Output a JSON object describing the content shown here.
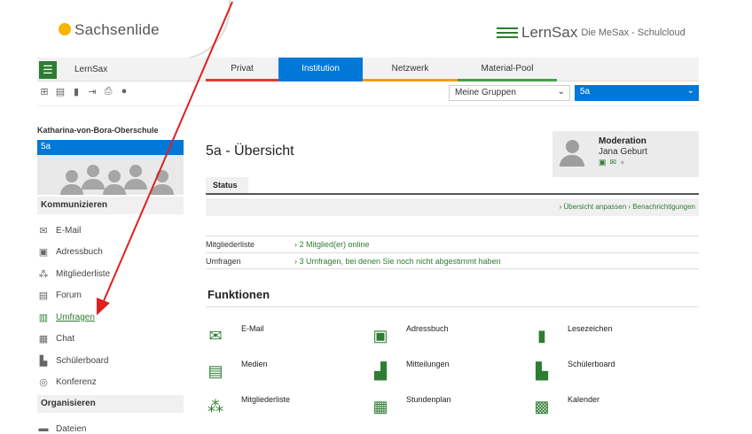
{
  "brand": {
    "left_logo": "Sachsenlide",
    "right_name": "LernSax",
    "right_sub": "Die MeSax - Schulcloud"
  },
  "nav": {
    "home_label": "LernSax",
    "menu_icon": "menu-icon",
    "tabs": [
      "Privat",
      "Institution",
      "Netzwerk",
      "Material-Pool"
    ]
  },
  "toolbar": {
    "icons": [
      "sitemap-icon",
      "note-icon",
      "bookmark-icon",
      "login-icon",
      "print-icon",
      "help-icon"
    ],
    "group_select": "Meine Gruppen",
    "class_select": "5a"
  },
  "sidebar": {
    "org": "Katharina-von-Bora-Oberschule",
    "class": "5a",
    "section_communicate": "Kommunizieren",
    "items": [
      {
        "label": "E-Mail",
        "icon": "mail-icon"
      },
      {
        "label": "Adressbuch",
        "icon": "addressbook-icon"
      },
      {
        "label": "Mitgliederliste",
        "icon": "members-icon"
      },
      {
        "label": "Forum",
        "icon": "forum-icon"
      },
      {
        "label": "Umfragen",
        "icon": "chart-icon"
      },
      {
        "label": "Chat",
        "icon": "chat-icon"
      },
      {
        "label": "Schülerboard",
        "icon": "board-icon"
      },
      {
        "label": "Konferenz",
        "icon": "conference-icon"
      }
    ],
    "section_organize": "Organisieren",
    "items2": [
      {
        "label": "Dateien",
        "icon": "files-icon"
      }
    ]
  },
  "main": {
    "title": "5a - Übersicht",
    "moderation": {
      "role": "Moderation",
      "name": "Jana Geburt"
    },
    "status_tab": "Status",
    "links": "› Übersicht anpassen  › Benachrichtigungen",
    "info": [
      {
        "key": "Mitgliederliste",
        "value": "› 2 Mitglied(er) online"
      },
      {
        "key": "Umfragen",
        "value": "› 3 Umfragen, bei denen Sie noch nicht abgestimmt haben"
      }
    ],
    "functions_title": "Funktionen",
    "functions": [
      {
        "label": "E-Mail",
        "icon": "mail-icon"
      },
      {
        "label": "Adressbuch",
        "icon": "addressbook-icon"
      },
      {
        "label": "Lesezeichen",
        "icon": "bookmark-icon"
      },
      {
        "label": "Medien",
        "icon": "media-icon"
      },
      {
        "label": "Mitteilungen",
        "icon": "messages-icon"
      },
      {
        "label": "Schülerboard",
        "icon": "board-icon"
      },
      {
        "label": "Mitgliederliste",
        "icon": "members-icon"
      },
      {
        "label": "Stundenplan",
        "icon": "timetable-icon"
      },
      {
        "label": "Kalender",
        "icon": "calendar-icon"
      }
    ]
  },
  "colors": {
    "accent_blue": "#0078d7",
    "accent_green": "#2e7d32",
    "annotation_red": "#e02020"
  }
}
